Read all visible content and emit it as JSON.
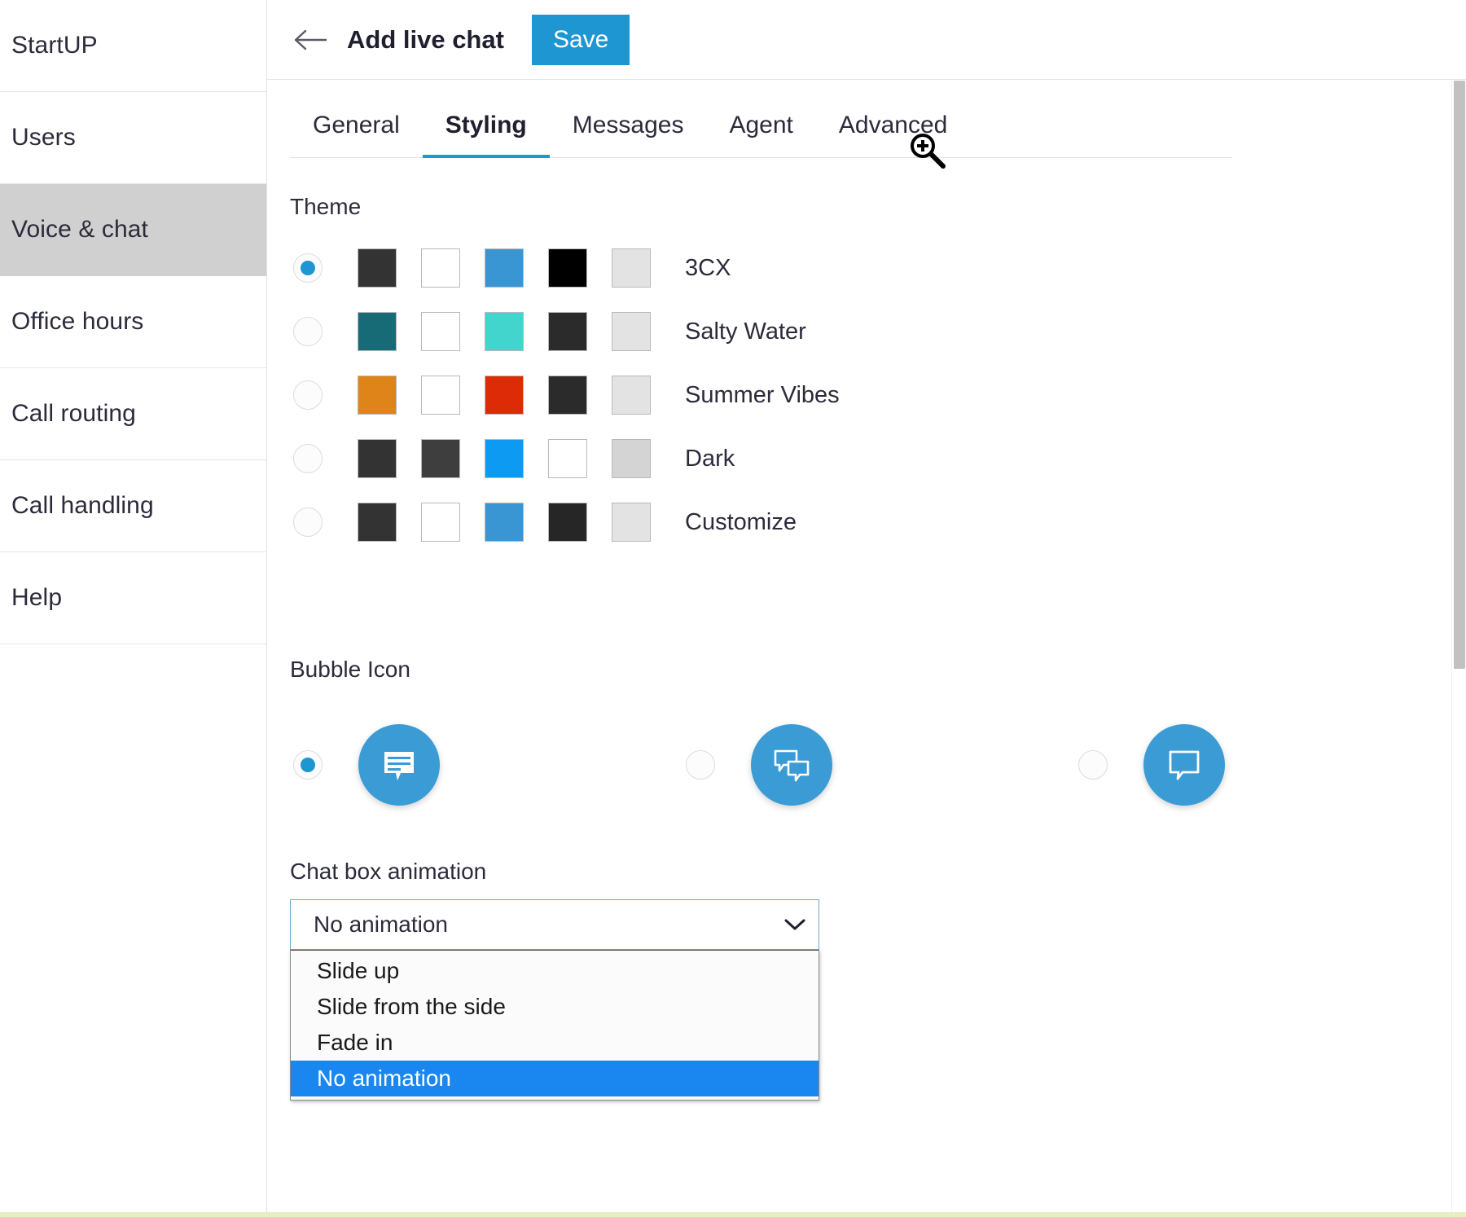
{
  "sidebar": {
    "items": [
      {
        "label": "StartUP",
        "name": "sidebar-item-startup",
        "active": false
      },
      {
        "label": "Users",
        "name": "sidebar-item-users",
        "active": false
      },
      {
        "label": "Voice & chat",
        "name": "sidebar-item-voice-chat",
        "active": true
      },
      {
        "label": "Office hours",
        "name": "sidebar-item-office-hours",
        "active": false
      },
      {
        "label": "Call routing",
        "name": "sidebar-item-call-routing",
        "active": false
      },
      {
        "label": "Call handling",
        "name": "sidebar-item-call-handling",
        "active": false
      },
      {
        "label": "Help",
        "name": "sidebar-item-help",
        "active": false
      }
    ]
  },
  "topbar": {
    "back_icon": "arrow-left-icon",
    "title": "Add live chat",
    "save_label": "Save",
    "save_color": "#1e96d2"
  },
  "tabs": {
    "items": [
      {
        "label": "General",
        "active": false
      },
      {
        "label": "Styling",
        "active": true
      },
      {
        "label": "Messages",
        "active": false
      },
      {
        "label": "Agent",
        "active": false
      },
      {
        "label": "Advanced",
        "active": false
      }
    ],
    "active_underline_color": "#1e96d2"
  },
  "theme": {
    "label": "Theme",
    "options": [
      {
        "name": "3CX",
        "selected": true,
        "swatches": [
          "#333333",
          "#ffffff",
          "#3a96d3",
          "#000000",
          "#e3e3e3"
        ]
      },
      {
        "name": "Salty Water",
        "selected": false,
        "swatches": [
          "#176b76",
          "#ffffff",
          "#42d5cd",
          "#2b2b2b",
          "#e3e3e3"
        ]
      },
      {
        "name": "Summer Vibes",
        "selected": false,
        "swatches": [
          "#df8418",
          "#ffffff",
          "#dd2b07",
          "#2b2b2b",
          "#e3e3e3"
        ]
      },
      {
        "name": "Dark",
        "selected": false,
        "swatches": [
          "#333333",
          "#3e3e3e",
          "#0d9af3",
          "#ffffff",
          "#d4d4d4"
        ]
      },
      {
        "name": "Customize",
        "selected": false,
        "swatches": [
          "#333333",
          "#ffffff",
          "#3a96d3",
          "#262626",
          "#e3e3e3"
        ]
      }
    ]
  },
  "bubble_icon": {
    "label": "Bubble Icon",
    "circle_color": "#3a9bd5",
    "options": [
      {
        "icon": "chat-bubble-filled-lines-icon",
        "selected": true
      },
      {
        "icon": "chat-bubbles-double-outline-icon",
        "selected": false
      },
      {
        "icon": "chat-bubble-outline-icon",
        "selected": false
      }
    ]
  },
  "animation": {
    "label": "Chat box animation",
    "value": "No animation",
    "expanded": true,
    "options": [
      {
        "label": "Slide up",
        "selected": false
      },
      {
        "label": "Slide from the side",
        "selected": false
      },
      {
        "label": "Fade in",
        "selected": false
      },
      {
        "label": "No animation",
        "selected": true
      }
    ],
    "highlight_color": "#1a87f0"
  },
  "cursor": {
    "icon": "zoom-in-cursor-icon"
  },
  "scrollbar": {
    "thumb_color": "#c1c1c1"
  }
}
